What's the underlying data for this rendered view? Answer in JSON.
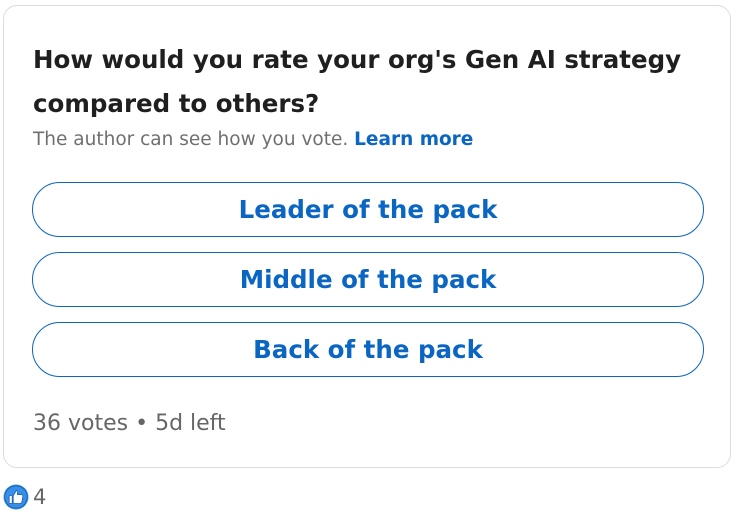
{
  "poll": {
    "question": "How would you rate your org's Gen AI strategy compared to others?",
    "visibility_text": "The author can see how you vote.",
    "learn_more_label": "Learn more",
    "options": [
      {
        "label": "Leader of the pack"
      },
      {
        "label": "Middle of the pack"
      },
      {
        "label": "Back of the pack"
      }
    ],
    "votes_text": "36 votes",
    "separator": "•",
    "time_left_text": "5d left"
  },
  "reactions": {
    "icon": "like-icon",
    "count": "4"
  },
  "colors": {
    "accent": "#0a66c2",
    "text_primary": "#1f1f1f",
    "text_secondary": "#666666",
    "border": "#dcdcdc"
  }
}
